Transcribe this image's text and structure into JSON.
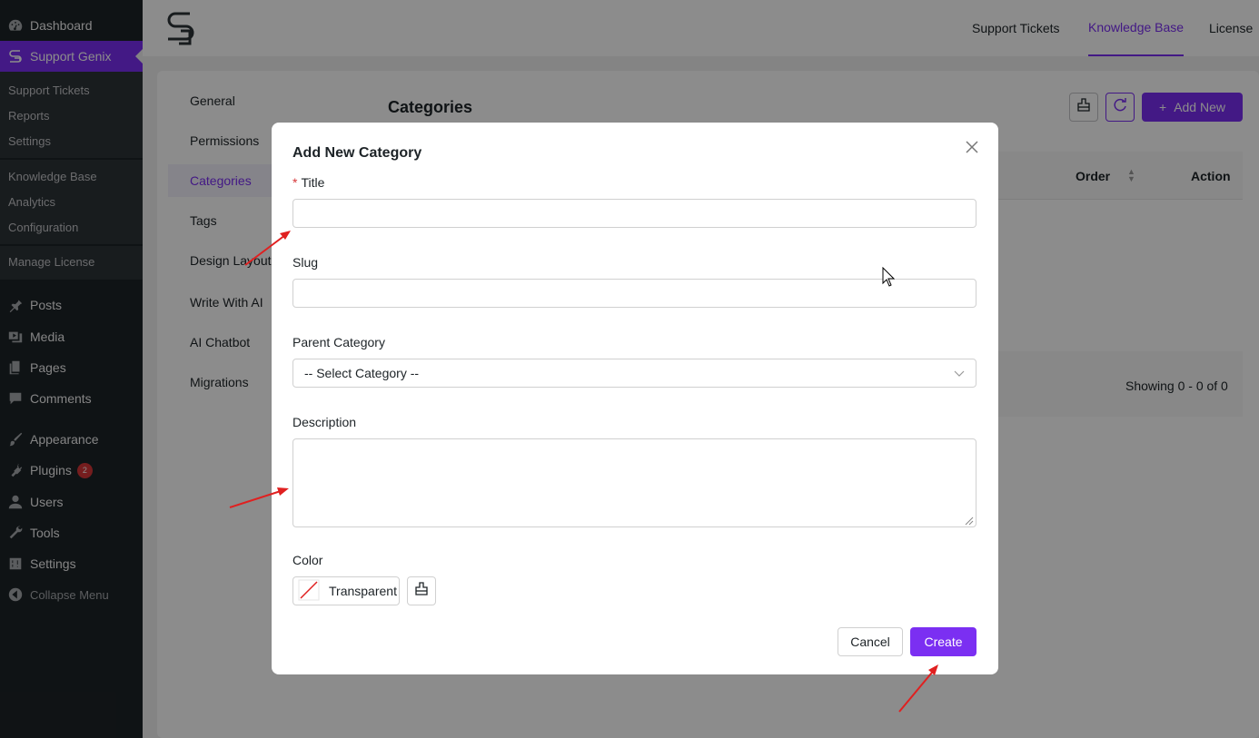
{
  "wp_menu": {
    "dashboard": "Dashboard",
    "support_genix": "Support Genix",
    "sub1": [
      "Support Tickets",
      "Reports",
      "Settings"
    ],
    "sub2": [
      "Knowledge Base",
      "Analytics",
      "Configuration"
    ],
    "sub3": [
      "Manage License"
    ],
    "posts": "Posts",
    "media": "Media",
    "pages": "Pages",
    "comments": "Comments",
    "appearance": "Appearance",
    "plugins": "Plugins",
    "plugins_badge": "2",
    "users": "Users",
    "tools": "Tools",
    "settings": "Settings",
    "collapse": "Collapse Menu"
  },
  "topbar": {
    "tabs": [
      "Support Tickets",
      "Knowledge Base",
      "License"
    ],
    "active_tab": "Knowledge Base"
  },
  "left_nav": [
    "General",
    "Permissions",
    "Categories",
    "Tags",
    "Design Layout",
    "Write With AI",
    "AI Chatbot",
    "Migrations"
  ],
  "page": {
    "title": "Categories",
    "add_new": "Add New",
    "col_order": "Order",
    "col_action": "Action",
    "showing": "Showing 0 - 0 of 0"
  },
  "modal": {
    "heading": "Add New Category",
    "title_label": "Title",
    "title_value": "",
    "slug_label": "Slug",
    "slug_value": "",
    "parent_label": "Parent Category",
    "parent_value": "-- Select Category --",
    "description_label": "Description",
    "description_value": "",
    "color_label": "Color",
    "color_value": "Transparent",
    "cancel": "Cancel",
    "create": "Create"
  },
  "colors": {
    "accent": "#7b2ff2",
    "wp_sidebar": "#1d2327",
    "annotation": "#e02020"
  }
}
